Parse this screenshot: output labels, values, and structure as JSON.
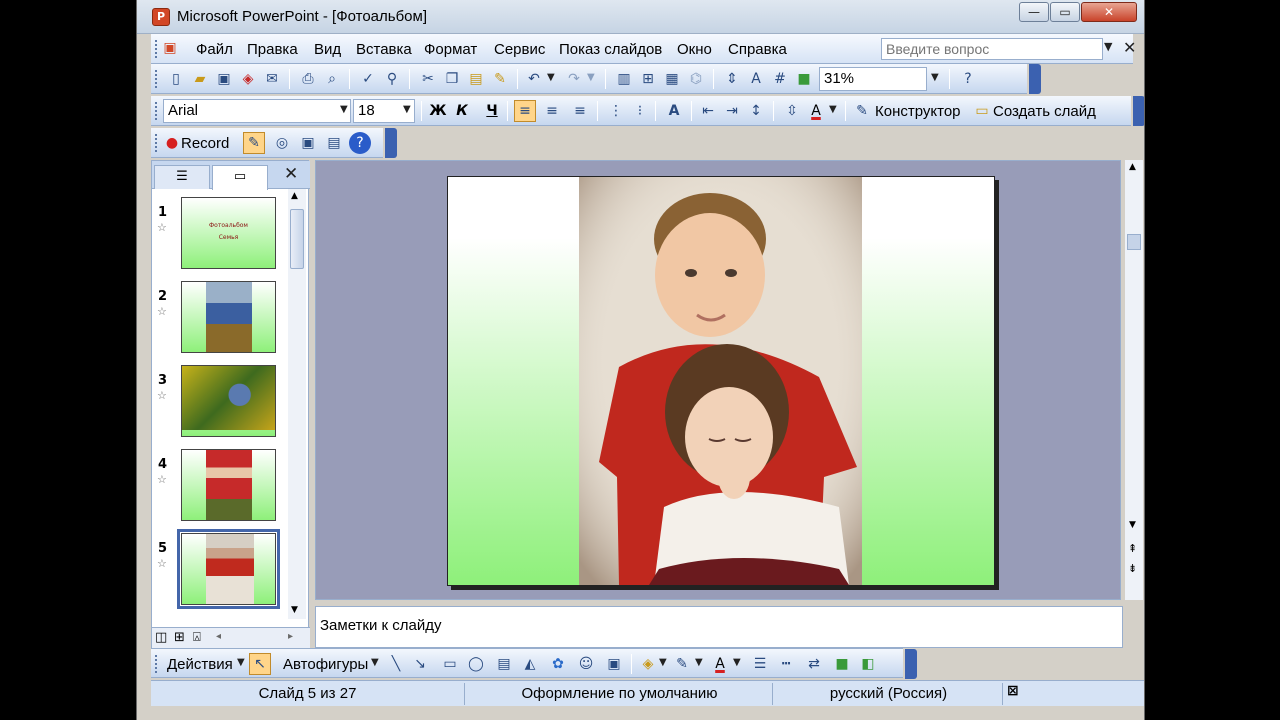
{
  "window": {
    "title": "Microsoft PowerPoint - [Фотоальбом]",
    "min_glyph": "—",
    "max_glyph": "▭",
    "close_glyph": "✕"
  },
  "menu": {
    "items": [
      "Файл",
      "Правка",
      "Вид",
      "Вставка",
      "Формат",
      "Сервис",
      "Показ слайдов",
      "Окно",
      "Справка"
    ],
    "help_placeholder": "Введите вопрос"
  },
  "toolbar": {
    "zoom": "31%",
    "font_name": "Arial",
    "font_size": "18",
    "bold_label": "Ж",
    "italic_label": "К",
    "underline_label": "Ч",
    "designer_label": "Конструктор",
    "new_slide_label": "Создать слайд",
    "record_label": "Record"
  },
  "slides": {
    "thumbnails": [
      {
        "num": "1",
        "title_line1": "Фотоальбом",
        "title_line2": "Семья"
      },
      {
        "num": "2"
      },
      {
        "num": "3"
      },
      {
        "num": "4"
      },
      {
        "num": "5"
      }
    ],
    "selected_index": 5
  },
  "notes": {
    "placeholder": "Заметки к слайду"
  },
  "drawing": {
    "actions_label": "Действия",
    "autoshapes_label": "Автофигуры"
  },
  "status": {
    "slide_counter": "Слайд 5 из 27",
    "design": "Оформление по умолчанию",
    "language": "русский (Россия)"
  }
}
